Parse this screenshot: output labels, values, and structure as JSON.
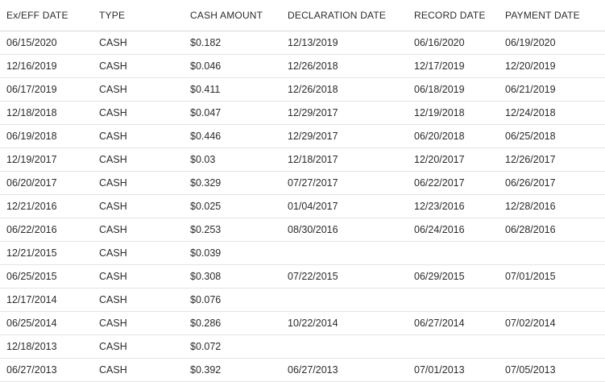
{
  "table": {
    "headers": [
      "Ex/EFF DATE",
      "TYPE",
      "CASH AMOUNT",
      "DECLARATION DATE",
      "RECORD DATE",
      "PAYMENT DATE"
    ],
    "rows": [
      [
        "06/15/2020",
        "CASH",
        "$0.182",
        "12/13/2019",
        "06/16/2020",
        "06/19/2020"
      ],
      [
        "12/16/2019",
        "CASH",
        "$0.046",
        "12/26/2018",
        "12/17/2019",
        "12/20/2019"
      ],
      [
        "06/17/2019",
        "CASH",
        "$0.411",
        "12/26/2018",
        "06/18/2019",
        "06/21/2019"
      ],
      [
        "12/18/2018",
        "CASH",
        "$0.047",
        "12/29/2017",
        "12/19/2018",
        "12/24/2018"
      ],
      [
        "06/19/2018",
        "CASH",
        "$0.446",
        "12/29/2017",
        "06/20/2018",
        "06/25/2018"
      ],
      [
        "12/19/2017",
        "CASH",
        "$0.03",
        "12/18/2017",
        "12/20/2017",
        "12/26/2017"
      ],
      [
        "06/20/2017",
        "CASH",
        "$0.329",
        "07/27/2017",
        "06/22/2017",
        "06/26/2017"
      ],
      [
        "12/21/2016",
        "CASH",
        "$0.025",
        "01/04/2017",
        "12/23/2016",
        "12/28/2016"
      ],
      [
        "06/22/2016",
        "CASH",
        "$0.253",
        "08/30/2016",
        "06/24/2016",
        "06/28/2016"
      ],
      [
        "12/21/2015",
        "CASH",
        "$0.039",
        "",
        "",
        ""
      ],
      [
        "06/25/2015",
        "CASH",
        "$0.308",
        "07/22/2015",
        "06/29/2015",
        "07/01/2015"
      ],
      [
        "12/17/2014",
        "CASH",
        "$0.076",
        "",
        "",
        ""
      ],
      [
        "06/25/2014",
        "CASH",
        "$0.286",
        "10/22/2014",
        "06/27/2014",
        "07/02/2014"
      ],
      [
        "12/18/2013",
        "CASH",
        "$0.072",
        "",
        "",
        ""
      ],
      [
        "06/27/2013",
        "CASH",
        "$0.392",
        "06/27/2013",
        "07/01/2013",
        "07/05/2013"
      ]
    ]
  }
}
